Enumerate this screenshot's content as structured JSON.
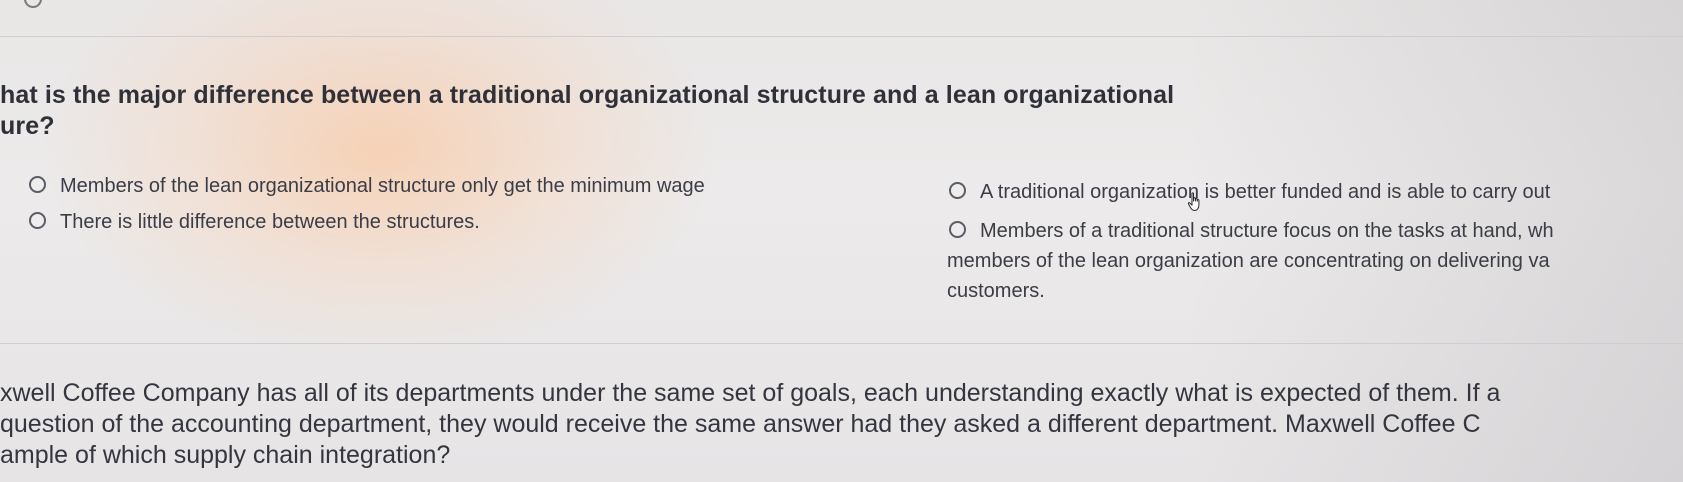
{
  "question1": {
    "title_line1": "hat is the major difference between a traditional organizational structure and a lean organizational",
    "title_line2": "ure?",
    "options": [
      {
        "label": "Members of the lean organizational structure only get the minimum wage"
      },
      {
        "label": "There is little difference between the structures."
      },
      {
        "label": "A traditional organization is better funded and is able to carry out"
      },
      {
        "label_line1": "Members of a traditional structure focus on the tasks at hand, wh",
        "label_line2": "members of the lean organization are concentrating on delivering va",
        "label_line3": "customers."
      }
    ]
  },
  "question2": {
    "line1": "xwell Coffee Company has all of its departments under the same set of goals, each understanding exactly what is expected of them. If a",
    "line2": "question of the accounting department, they would receive the same answer had they asked a different department. Maxwell Coffee C",
    "line3": "ample of which supply chain integration?"
  },
  "icons": {
    "cursor": "hand-pointer-icon",
    "radio": "radio-button-icon",
    "top": "circle-icon"
  }
}
